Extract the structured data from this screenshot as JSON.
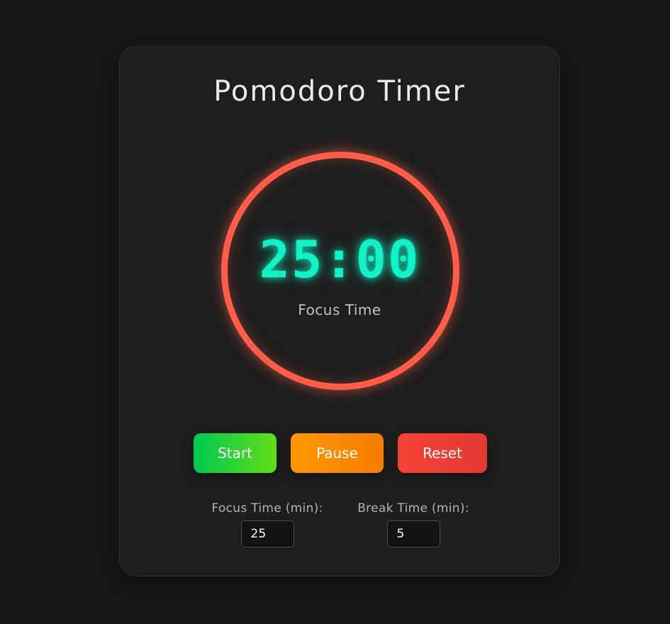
{
  "app": {
    "title": "Pomodoro Timer"
  },
  "timer": {
    "display": "25:00",
    "mode_label": "Focus Time",
    "ring_color": "#ff5d48",
    "digits_color": "#13f2c6"
  },
  "controls": {
    "start_label": "Start",
    "pause_label": "Pause",
    "reset_label": "Reset",
    "start_color": "#00c853",
    "pause_color": "#ff9800",
    "reset_color": "#f44336"
  },
  "settings": {
    "focus_label": "Focus Time (min):",
    "focus_value": "25",
    "break_label": "Break Time (min):",
    "break_value": "5"
  }
}
